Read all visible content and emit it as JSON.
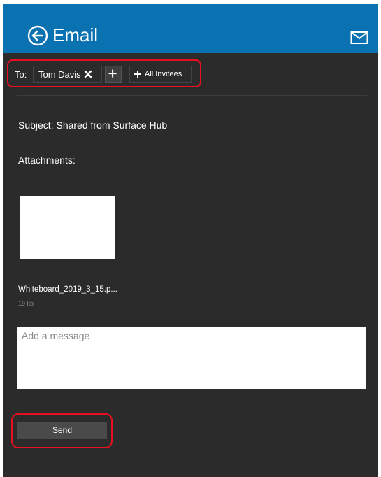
{
  "header": {
    "title": "Email",
    "back_icon": "back-arrow-circle-icon",
    "mail_icon": "envelope-icon",
    "bg": "#0a72b1"
  },
  "to": {
    "label": "To:",
    "recipients": [
      {
        "name": "Tom Davis"
      }
    ],
    "add_icon": "plus-icon",
    "all_invitees_label": "All Invitees"
  },
  "subject": "Subject:  Shared from Surface Hub",
  "attachments": {
    "label": "Attachments:",
    "files": [
      {
        "name": "Whiteboard_2019_3_15.p...",
        "size": "19 kb"
      }
    ]
  },
  "message": {
    "placeholder": "Add a message",
    "value": ""
  },
  "send_label": "Send",
  "highlight_color": "#e8101f"
}
